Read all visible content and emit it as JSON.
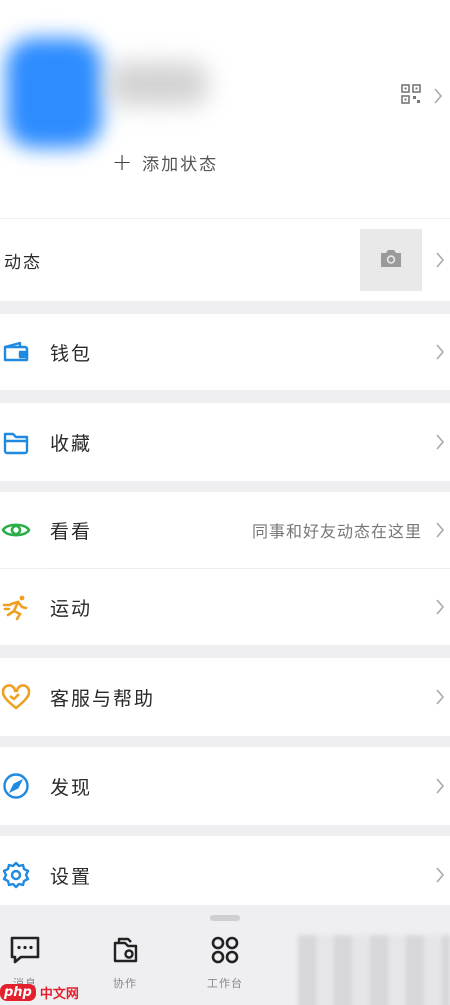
{
  "profile": {
    "add_status_label": "添加状态"
  },
  "moments": {
    "label": "动态"
  },
  "menu": {
    "wallet": "钱包",
    "favorites": "收藏",
    "watch": {
      "label": "看看",
      "hint": "同事和好友动态在这里"
    },
    "sports": "运动",
    "support": "客服与帮助",
    "discover": "发现",
    "settings": "设置"
  },
  "tabs": [
    {
      "label": "消息"
    },
    {
      "label": "协作"
    },
    {
      "label": "工作台"
    }
  ],
  "watermark": {
    "logo": "php",
    "text": "中文网"
  },
  "colors": {
    "blue": "#1f8ae0",
    "green": "#2bae4a",
    "orange": "#f0a020",
    "watermark_red": "#e2212d"
  }
}
